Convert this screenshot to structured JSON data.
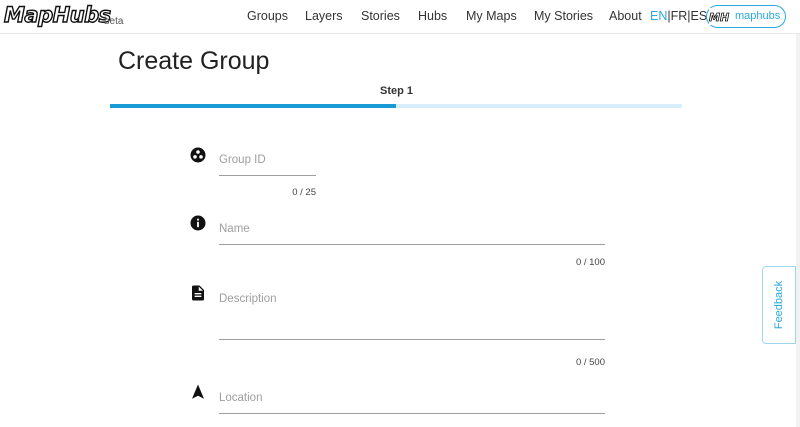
{
  "brand": {
    "logo": "MapHubs",
    "tag": "beta"
  },
  "nav": {
    "links": [
      "Groups",
      "Layers",
      "Stories",
      "Hubs",
      "My Maps",
      "My Stories",
      "About"
    ],
    "languages": {
      "active": "EN",
      "sep": "|",
      "others": [
        "FR",
        "ES"
      ]
    },
    "user": {
      "avatar_text": "MH",
      "name": "maphubs"
    }
  },
  "page": {
    "title": "Create Group"
  },
  "stepper": {
    "label": "Step 1",
    "progress": 0.5,
    "color": "#1a9ad6",
    "track_color": "#d9eefb"
  },
  "form": {
    "fields": [
      {
        "icon": "group-work-icon",
        "label": "Group ID",
        "counter": "0 / 25"
      },
      {
        "icon": "info-icon",
        "label": "Name",
        "counter": "0 / 100"
      },
      {
        "icon": "description-icon",
        "label": "Description",
        "counter": "0 / 500"
      },
      {
        "icon": "navigation-icon",
        "label": "Location",
        "counter": ""
      }
    ]
  },
  "feedback": {
    "label": "Feedback"
  },
  "colors": {
    "accent": "#29a9df"
  }
}
